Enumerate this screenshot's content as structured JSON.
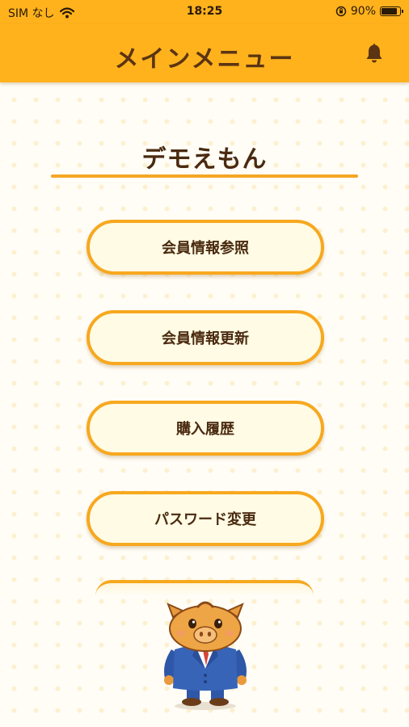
{
  "status_bar": {
    "carrier": "SIM なし",
    "time": "18:25",
    "battery_percent": "90%",
    "battery_level": 0.9
  },
  "header": {
    "title": "メインメニュー",
    "bell_icon": "bell-icon"
  },
  "user": {
    "name": "デモえもん"
  },
  "menu": {
    "items": [
      {
        "label": "会員情報参照"
      },
      {
        "label": "会員情報更新"
      },
      {
        "label": "購入履歴"
      },
      {
        "label": "パスワード変更"
      }
    ]
  },
  "colors": {
    "header_bg": "#ffb21c",
    "accent": "#f7a81f",
    "button_bg": "#fffbe4",
    "text": "#4a2a10"
  }
}
